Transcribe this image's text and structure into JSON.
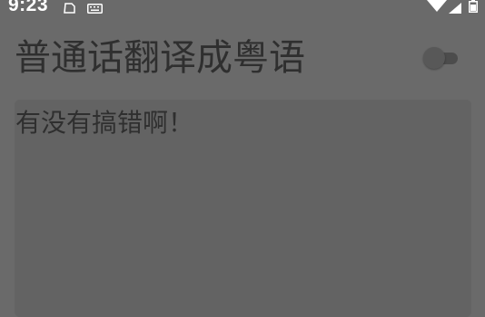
{
  "status_bar": {
    "time": "9:23",
    "icons": [
      "file-icon",
      "keyboard-icon",
      "wifi-icon",
      "signal-icon",
      "battery-icon"
    ]
  },
  "header": {
    "title": "普通话翻译成粤语",
    "toggle": {
      "state": "off"
    }
  },
  "input_card": {
    "text": "有没有搞错啊！"
  },
  "colors": {
    "background": "#6a6a6a",
    "card": "#636363",
    "text": "#2f2f2f",
    "status_text": "#ffffff"
  }
}
